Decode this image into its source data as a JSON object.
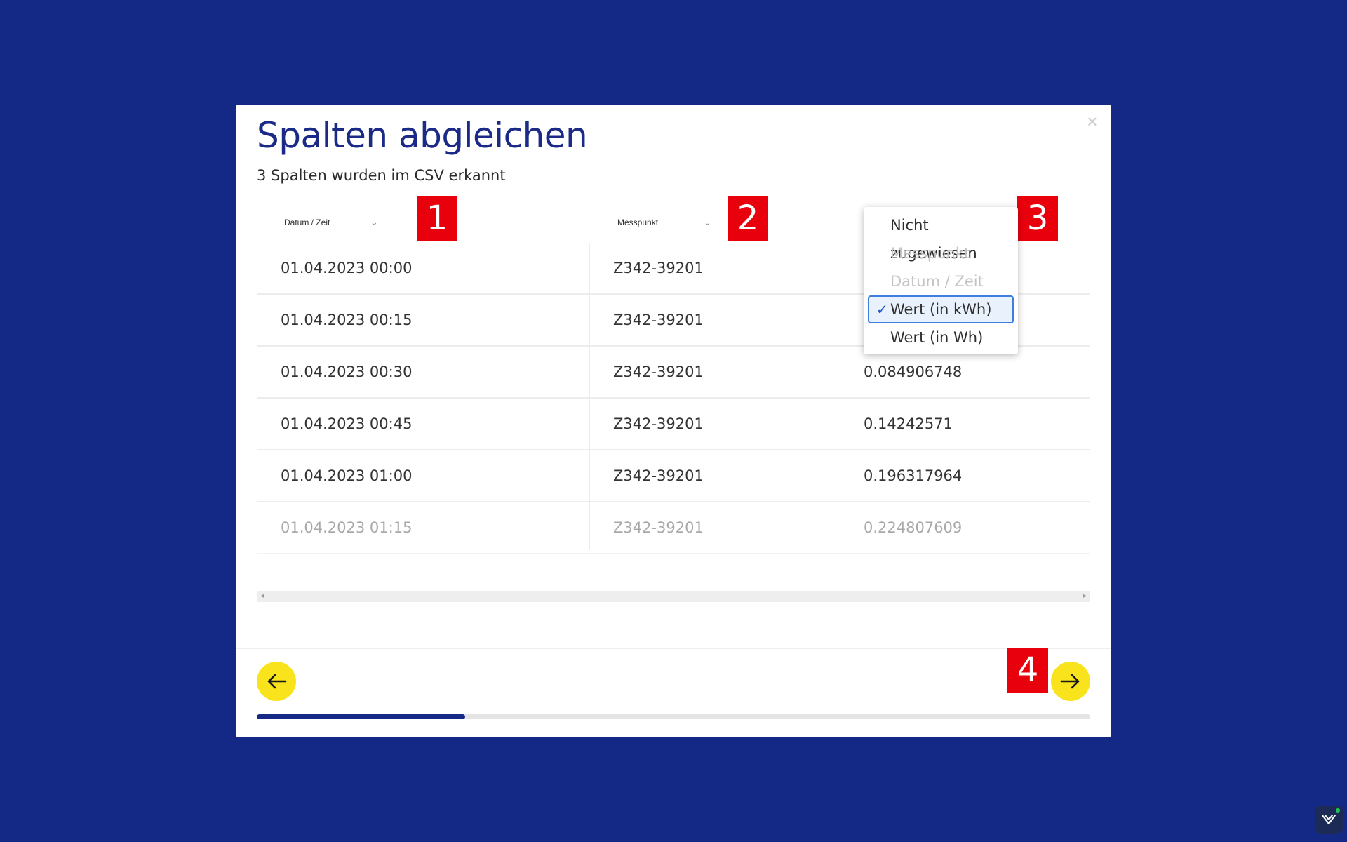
{
  "modal": {
    "title": "Spalten abgleichen",
    "subtitle": "3 Spalten wurden im CSV erkannt"
  },
  "columns": [
    {
      "label": "Datum / Zeit"
    },
    {
      "label": "Messpunkt"
    }
  ],
  "rows": [
    [
      "01.04.2023 00:00",
      "Z342-39201",
      ""
    ],
    [
      "01.04.2023 00:15",
      "Z342-39201",
      ""
    ],
    [
      "01.04.2023 00:30",
      "Z342-39201",
      "0.084906748"
    ],
    [
      "01.04.2023 00:45",
      "Z342-39201",
      "0.14242571"
    ],
    [
      "01.04.2023 01:00",
      "Z342-39201",
      "0.196317964"
    ],
    [
      "01.04.2023 01:15",
      "Z342-39201",
      "0.224807609"
    ]
  ],
  "dropdown": {
    "options": [
      {
        "label": "Nicht zugewiesen",
        "state": "enabled"
      },
      {
        "label": "Messpunkt",
        "state": "disabled"
      },
      {
        "label": "Datum / Zeit",
        "state": "disabled"
      },
      {
        "label": "Wert (in kWh)",
        "state": "selected"
      },
      {
        "label": "Wert (in Wh)",
        "state": "enabled"
      }
    ]
  },
  "badges": [
    "1",
    "2",
    "3",
    "4"
  ],
  "progress": {
    "fraction": 0.25
  },
  "icons": {
    "close": "close-icon",
    "back": "arrow-left-icon",
    "next": "arrow-right-icon",
    "check": "check-icon",
    "chevron": "chevron-down-icon"
  },
  "colors": {
    "background": "#142886",
    "title": "#1a2a86",
    "accent_button": "#f8e31c",
    "badge": "#e8000d",
    "progress": "#152a86"
  }
}
